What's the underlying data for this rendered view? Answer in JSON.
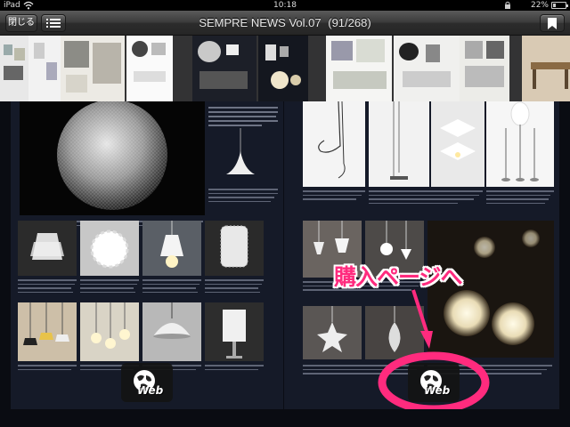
{
  "status_bar": {
    "carrier": "iPad",
    "time": "10:18",
    "battery": "22%",
    "battery_level": 0.22
  },
  "nav": {
    "close_label": "閉じる",
    "title": "SEMPRE NEWS Vol.07",
    "page_counter": "(91/268)"
  },
  "thumbnails": [
    {
      "id": "thumb-1"
    },
    {
      "id": "thumb-2"
    },
    {
      "id": "thumb-3"
    },
    {
      "id": "thumb-4"
    },
    {
      "id": "thumb-5",
      "selected": true
    },
    {
      "id": "thumb-6"
    },
    {
      "id": "thumb-7"
    },
    {
      "id": "thumb-8"
    }
  ],
  "badges": {
    "web_left": "Web",
    "web_right": "Web"
  },
  "annotation": {
    "callout": "購入ページへ",
    "color": "#ff2b7e"
  },
  "colors": {
    "page_bg": "#151a28",
    "selected_thumb": "#c62a2a"
  }
}
